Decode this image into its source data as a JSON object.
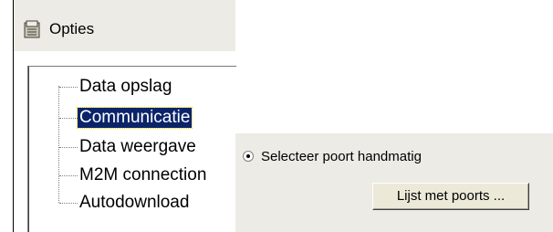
{
  "window": {
    "title": "Opties",
    "title_icon": "options-folder-icon"
  },
  "tree": {
    "items": [
      {
        "label": "Data opslag",
        "selected": false
      },
      {
        "label": "Communicatie",
        "selected": true
      },
      {
        "label": "Data weergave",
        "selected": false
      },
      {
        "label": "M2M connection",
        "selected": false
      },
      {
        "label": "Autodownload",
        "selected": false
      }
    ]
  },
  "panel": {
    "radio_label": "Selecteer poort handmatig",
    "radio_checked": true,
    "list_ports_button": "Lijst met poorts ..."
  },
  "colors": {
    "selection_bg": "#0a246a",
    "pane_bg": "#ecebe6"
  }
}
